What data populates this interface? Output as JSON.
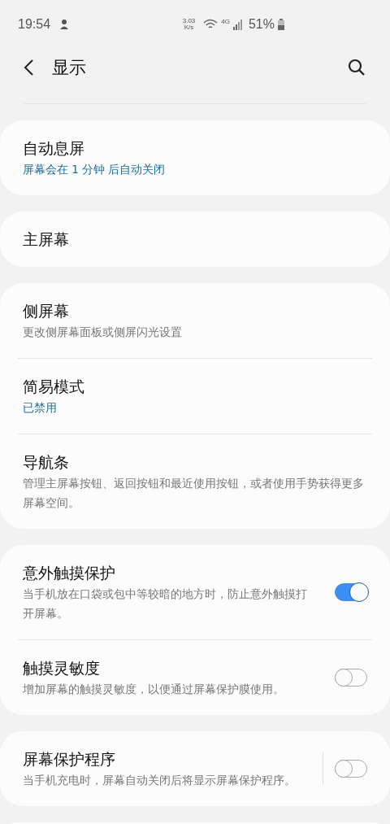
{
  "status_bar": {
    "time": "19:54",
    "speed_value": "3.03",
    "speed_unit": "K/s",
    "network": "4G",
    "battery": "51%"
  },
  "header": {
    "title": "显示"
  },
  "groups": [
    {
      "items": [
        {
          "kind": "link",
          "title": "自动息屏",
          "subtitle": "屏幕会在 1 分钟 后自动关闭",
          "accent": true
        }
      ]
    },
    {
      "items": [
        {
          "kind": "link",
          "title": "主屏幕"
        }
      ]
    },
    {
      "items": [
        {
          "kind": "link",
          "title": "侧屏幕",
          "subtitle": "更改侧屏幕面板或侧屏闪光设置",
          "accent": false
        },
        {
          "kind": "link",
          "title": "简易模式",
          "subtitle": "已禁用",
          "accent": true
        },
        {
          "kind": "link",
          "title": "导航条",
          "subtitle": "管理主屏幕按钮、返回按钮和最近使用按钮，或者使用手势获得更多屏幕空间。",
          "accent": false
        }
      ]
    },
    {
      "items": [
        {
          "kind": "toggle",
          "title": "意外触摸保护",
          "subtitle": "当手机放在口袋或包中等较暗的地方时，防止意外触摸打开屏幕。",
          "accent": false,
          "on": true,
          "separated": false
        },
        {
          "kind": "toggle",
          "title": "触摸灵敏度",
          "subtitle": "增加屏幕的触摸灵敏度，以便通过屏幕保护膜使用。",
          "accent": false,
          "on": false,
          "separated": false
        }
      ]
    },
    {
      "items": [
        {
          "kind": "toggle",
          "title": "屏幕保护程序",
          "subtitle": "当手机充电时，屏幕自动关闭后将显示屏幕保护程序。",
          "accent": false,
          "on": false,
          "separated": true
        }
      ]
    }
  ]
}
